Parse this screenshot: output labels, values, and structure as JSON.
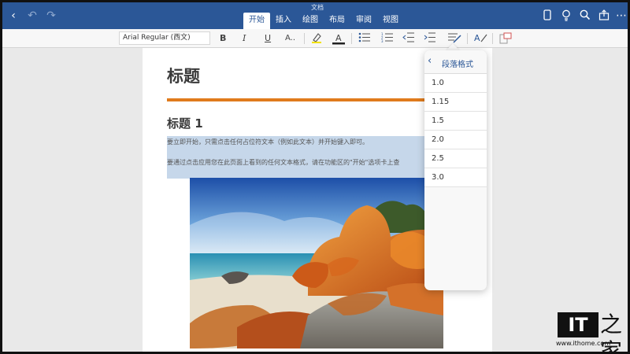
{
  "app": {
    "title": "文档"
  },
  "ribbon": {
    "tabs": [
      {
        "label": "开始",
        "active": true
      },
      {
        "label": "插入"
      },
      {
        "label": "绘图"
      },
      {
        "label": "布局"
      },
      {
        "label": "审阅"
      },
      {
        "label": "视图"
      }
    ]
  },
  "toolbar": {
    "font_name": "Arial Regular (西文)"
  },
  "document": {
    "heading": "标题",
    "heading1": "标题 1",
    "para1": "要立即开始，只需点击任何占位符文本（例如此文本）并开始键入即可。",
    "para2": "要通过点击应用您在此页面上看到的任何文本格式，请在功能区的\"开始\"选项卡上查"
  },
  "popover": {
    "title": "段落格式",
    "options": [
      "1.0",
      "1.15",
      "1.5",
      "2.0",
      "2.5",
      "3.0"
    ]
  },
  "watermark": {
    "logo": "IT",
    "glyph": "之家",
    "url": "www.ithome.com"
  },
  "colors": {
    "ribbon": "#2b5797",
    "accent_rule": "#e07b1c",
    "selection": "#c6d7ea"
  }
}
